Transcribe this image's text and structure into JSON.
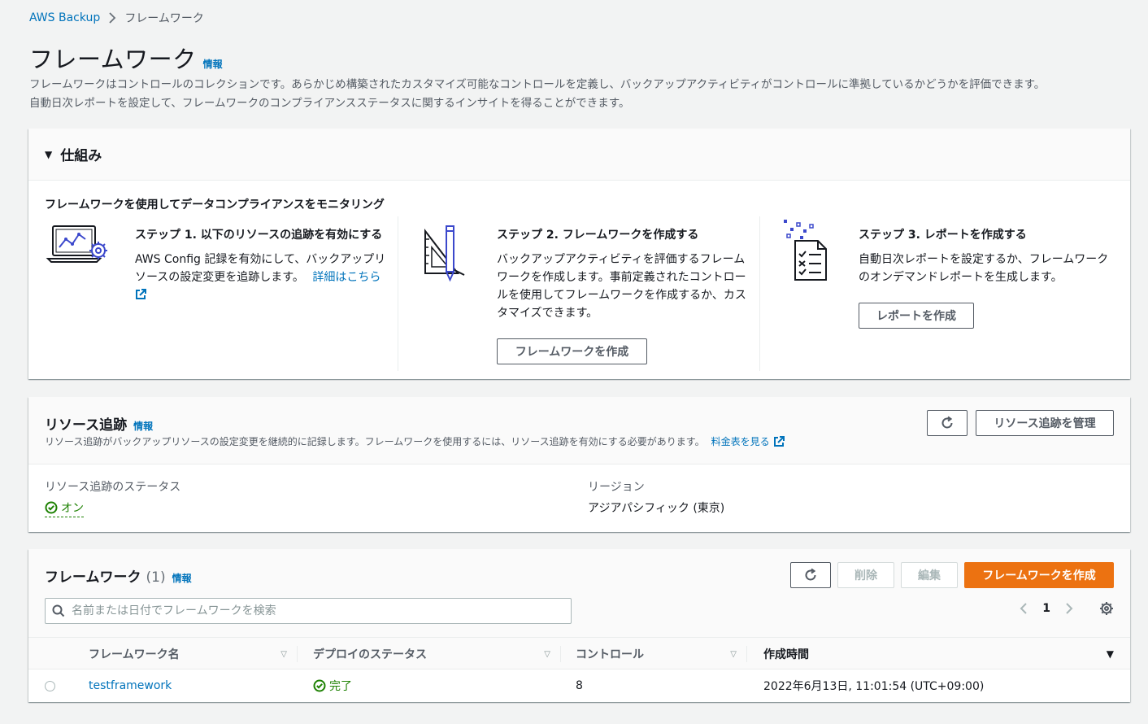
{
  "breadcrumb": {
    "root": "AWS Backup",
    "current": "フレームワーク"
  },
  "header": {
    "title": "フレームワーク",
    "info": "情報",
    "description_line1": "フレームワークはコントロールのコレクションです。あらかじめ構築されたカスタマイズ可能なコントロールを定義し、バックアップアクティビティがコントロールに準拠しているかどうかを評価できます。",
    "description_line2": "自動日次レポートを設定して、フレームワークのコンプライアンスステータスに関するインサイトを得ることができます。"
  },
  "how_it_works": {
    "title": "仕組み",
    "subtitle": "フレームワークを使用してデータコンプライアンスをモニタリング",
    "step1": {
      "title": "ステップ 1. 以下のリソースの追跡を有効にする",
      "text_line1": "AWS Config 記録を有効にして、バックアップリ",
      "text_line2": "ソースの設定変更を追跡します。",
      "link": "詳細はこちら"
    },
    "step2": {
      "title": "ステップ 2. フレームワークを作成する",
      "text_line1": "バックアップアクティビティを評価するフレーム",
      "text_line2": "ワークを作成します。事前定義されたコントロー",
      "text_line3": "ルを使用してフレームワークを作成するか、カス",
      "text_line4": "タマイズできます。",
      "button": "フレームワークを作成"
    },
    "step3": {
      "title": "ステップ 3. レポートを作成する",
      "text_line1": "自動日次レポートを設定するか、フレームワーク",
      "text_line2": "のオンデマンドレポートを生成します。",
      "button": "レポートを作成"
    }
  },
  "resource_tracking": {
    "title": "リソース追跡",
    "info": "情報",
    "description": "リソース追跡がバックアップリソースの設定変更を継続的に記録します。フレームワークを使用するには、リソース追跡を有効にする必要があります。",
    "pricing_link": "料金表を見る",
    "manage_button": "リソース追跡を管理",
    "status_label": "リソース追跡のステータス",
    "status_value": "オン",
    "region_label": "リージョン",
    "region_value": "アジアパシフィック (東京)"
  },
  "frameworks": {
    "title": "フレームワーク",
    "count": "(1)",
    "info": "情報",
    "delete_button": "削除",
    "edit_button": "編集",
    "create_button": "フレームワークを作成",
    "search_placeholder": "名前または日付でフレームワークを検索",
    "page": "1",
    "columns": [
      "フレームワーク名",
      "デプロイのステータス",
      "コントロール",
      "作成時間"
    ],
    "rows": [
      {
        "name": "testframework",
        "status": "完了",
        "controls": "8",
        "created": "2022年6月13日, 11:01:54 (UTC+09:00)"
      }
    ]
  },
  "colors": {
    "link": "#0073bb",
    "primary": "#ec7211",
    "success": "#1d8102"
  }
}
